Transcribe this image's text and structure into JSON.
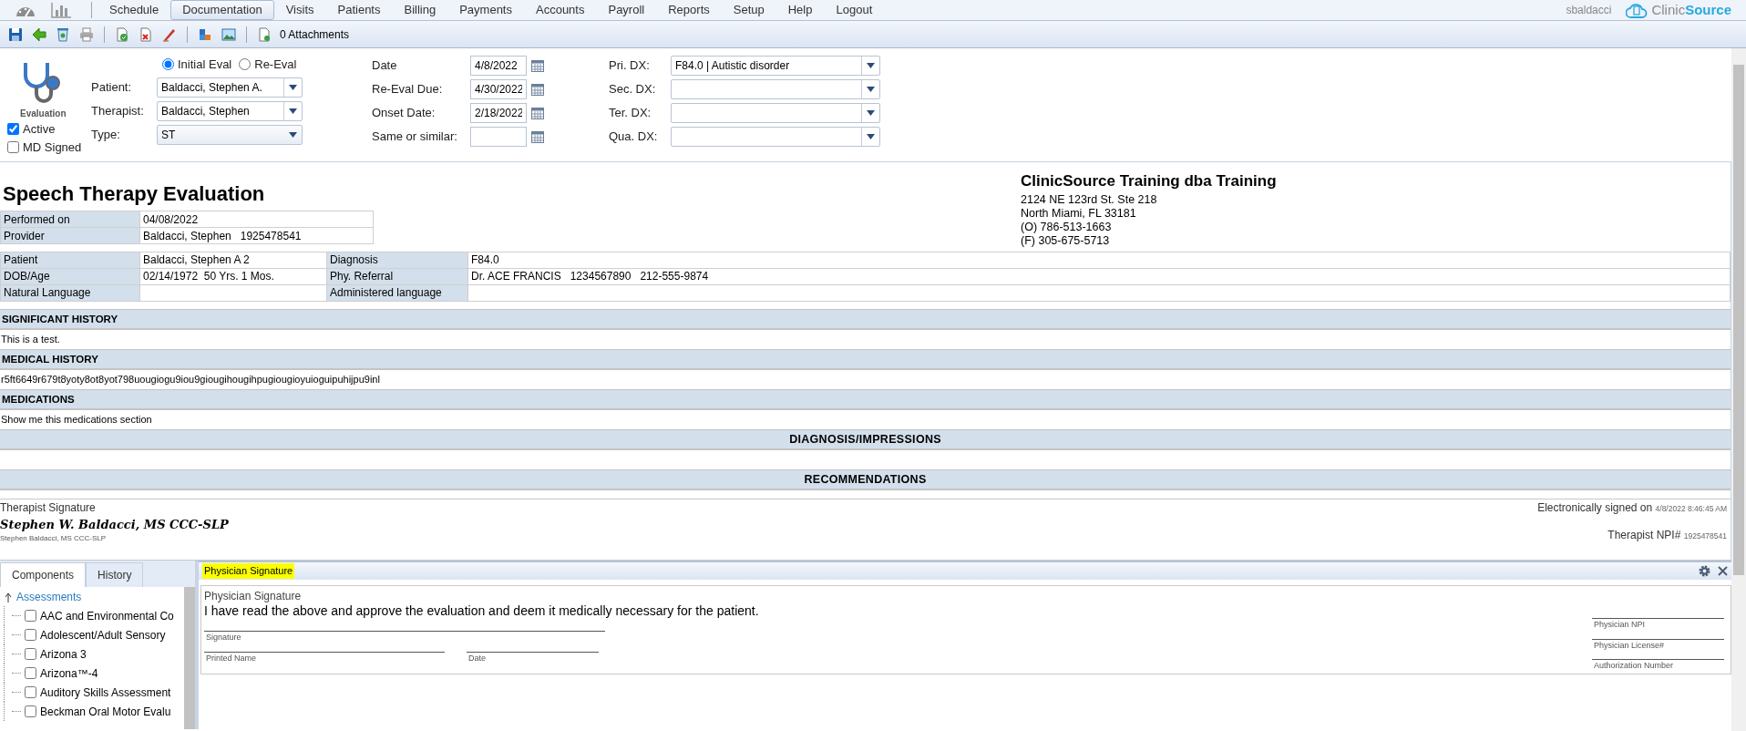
{
  "menu": {
    "items": [
      {
        "label": "Schedule",
        "selected": false
      },
      {
        "label": "Documentation",
        "selected": true
      },
      {
        "label": "Visits",
        "selected": false
      },
      {
        "label": "Patients",
        "selected": false
      },
      {
        "label": "Billing",
        "selected": false
      },
      {
        "label": "Payments",
        "selected": false
      },
      {
        "label": "Accounts",
        "selected": false
      },
      {
        "label": "Payroll",
        "selected": false
      },
      {
        "label": "Reports",
        "selected": false
      },
      {
        "label": "Setup",
        "selected": false
      },
      {
        "label": "Help",
        "selected": false
      },
      {
        "label": "Logout",
        "selected": false
      }
    ],
    "user": "sbaldacci",
    "logo": {
      "text": "Clinic",
      "emphasis": "Source"
    }
  },
  "toolbar": {
    "attachments": "0 Attachments"
  },
  "header": {
    "badge": "Evaluation",
    "flags": [
      {
        "label": "Active",
        "checked": true
      },
      {
        "label": "MD Signed",
        "checked": false
      }
    ],
    "eval_type": [
      {
        "label": "Initial Eval",
        "selected": true
      },
      {
        "label": "Re-Eval",
        "selected": false
      }
    ],
    "fields": [
      {
        "label": "Patient:",
        "value": "Baldacci, Stephen A.",
        "kind": "combo"
      },
      {
        "label": "Therapist:",
        "value": "Baldacci, Stephen",
        "kind": "combo"
      },
      {
        "label": "Type:",
        "value": "ST",
        "kind": "select"
      }
    ],
    "dates": [
      {
        "label": "Date",
        "value": "4/8/2022"
      },
      {
        "label": "Re-Eval Due:",
        "value": "4/30/2022"
      },
      {
        "label": "Onset Date:",
        "value": "2/18/2022"
      },
      {
        "label": "Same or similar:"
      }
    ],
    "diagnoses": [
      {
        "label": "Pri. DX:",
        "value": "F84.0 | Autistic disorder"
      },
      {
        "label": "Sec. DX:"
      },
      {
        "label": "Ter. DX:"
      },
      {
        "label": "Qua. DX:"
      }
    ]
  },
  "report": {
    "title": "Speech Therapy Evaluation",
    "company": {
      "name": "ClinicSource Training dba Training",
      "lines": [
        "2124 NE 123rd St. Ste 218",
        "North Miami, FL 33181",
        "(O) 786-513-1663",
        "(F) 305-675-5713"
      ]
    },
    "summary": [
      {
        "label": "Performed on",
        "value": "04/08/2022"
      },
      {
        "label": "Provider",
        "value": "Baldacci, Stephen   1925478541"
      }
    ],
    "details": [
      [
        {
          "label": "Patient",
          "value": "Baldacci, Stephen A 2"
        },
        {
          "label": "Diagnosis",
          "value": "F84.0"
        }
      ],
      [
        {
          "label": "DOB/Age",
          "value": "02/14/1972  50 Yrs. 1 Mos."
        },
        {
          "label": "Phy. Referral",
          "value": "Dr. ACE FRANCIS   1234567890   212-555-9874"
        }
      ],
      [
        {
          "label": "Natural Language"
        },
        {
          "label": "Administered language"
        }
      ]
    ],
    "sections": [
      {
        "heading": "SIGNIFICANT HISTORY",
        "kind": "left",
        "body": "This is a test."
      },
      {
        "heading": "MEDICAL HISTORY",
        "kind": "left",
        "body": "r5ft6649r679t8yoty8ot8yot798uougiogu9iou9giougihougihpugiougioyuioguipuhijpu9inl"
      },
      {
        "heading": "MEDICATIONS",
        "kind": "left",
        "body": "Show me this medications section"
      },
      {
        "heading": "DIAGNOSIS/IMPRESSIONS",
        "kind": "center"
      },
      {
        "heading": "RECOMMENDATIONS",
        "kind": "center"
      }
    ],
    "signature": {
      "label": "Therapist Signature",
      "signature": "Stephen W. Baldacci, MS CCC-SLP",
      "name": "Stephen Baldacci, MS CCC-SLP",
      "signed_label": "Electronically signed on",
      "signed_at": "4/8/2022 8:46:45 AM",
      "npi_label": "Therapist NPI#",
      "npi": "1925478541"
    }
  },
  "components_panel": {
    "tabs": [
      {
        "label": "Components",
        "selected": true
      },
      {
        "label": "History",
        "selected": false
      }
    ],
    "tree": [
      {
        "label": "Assessments",
        "expanded": true,
        "children": [
          {
            "label": "AAC and Environmental Co",
            "checked": false
          },
          {
            "label": "Adolescent/Adult Sensory",
            "checked": false
          },
          {
            "label": "Arizona 3",
            "checked": false
          },
          {
            "label": "Arizona™-4",
            "checked": false
          },
          {
            "label": "Auditory Skills Assessment",
            "checked": false
          },
          {
            "label": "Beckman Oral Motor Evalu",
            "checked": false
          }
        ]
      }
    ]
  },
  "physician_panel": {
    "title": "Physician Signature",
    "caption": "Physician Signature",
    "statement": "I have read the above and approve the evaluation and deem it medically necessary for the patient.",
    "signature_line": "Signature",
    "printed_name_line": "Printed Name",
    "date_line": "Date",
    "right_lines": [
      "Physician NPI",
      "Physician License#",
      "Authorization Number"
    ]
  }
}
